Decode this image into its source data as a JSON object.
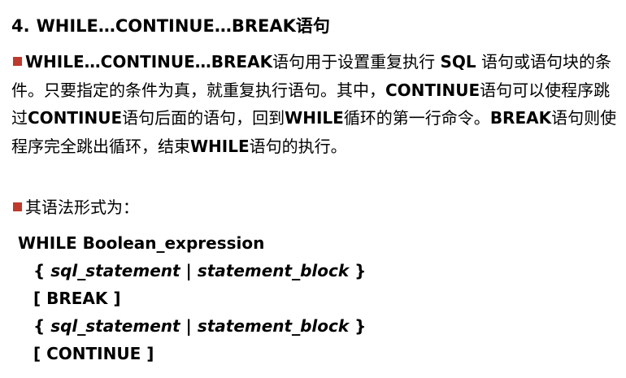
{
  "heading": {
    "number": "4.",
    "title": "WHILE…CONTINUE…BREAK语句"
  },
  "paragraph1": {
    "bold_lead": "WHILE…CONTINUE…BREAK",
    "text_a": "语句用于设置重复执行 ",
    "kw_sql": "SQL",
    "text_b": " 语句或语句块的条件。只要指定的条件为真，就重复执行语句。其中，",
    "kw_continue1": "CONTINUE",
    "text_c": "语句可以使程序跳过",
    "kw_continue2": "CONTINUE",
    "text_d": "语句后面的语句，回到",
    "kw_while1": "WHILE",
    "text_e": "循环的第一行命令。",
    "kw_break": "BREAK",
    "text_f": "语句则使程序完全跳出循环，结束",
    "kw_while2": "WHILE",
    "text_g": "语句的执行。"
  },
  "paragraph2": {
    "text": "其语法形式为："
  },
  "syntax": {
    "line1": "WHILE Boolean_expression",
    "brace_open": "{ ",
    "sql_statement": "sql_statement",
    "pipe": " | ",
    "statement_block": "statement_block",
    "brace_close": " }",
    "break_line": "[ BREAK ]",
    "continue_line": "[ CONTINUE ]"
  },
  "colors": {
    "bullet": "#c0392b",
    "text": "#000000",
    "background": "#ffffff"
  },
  "icons": {
    "bullet": "square-bullet-icon"
  }
}
